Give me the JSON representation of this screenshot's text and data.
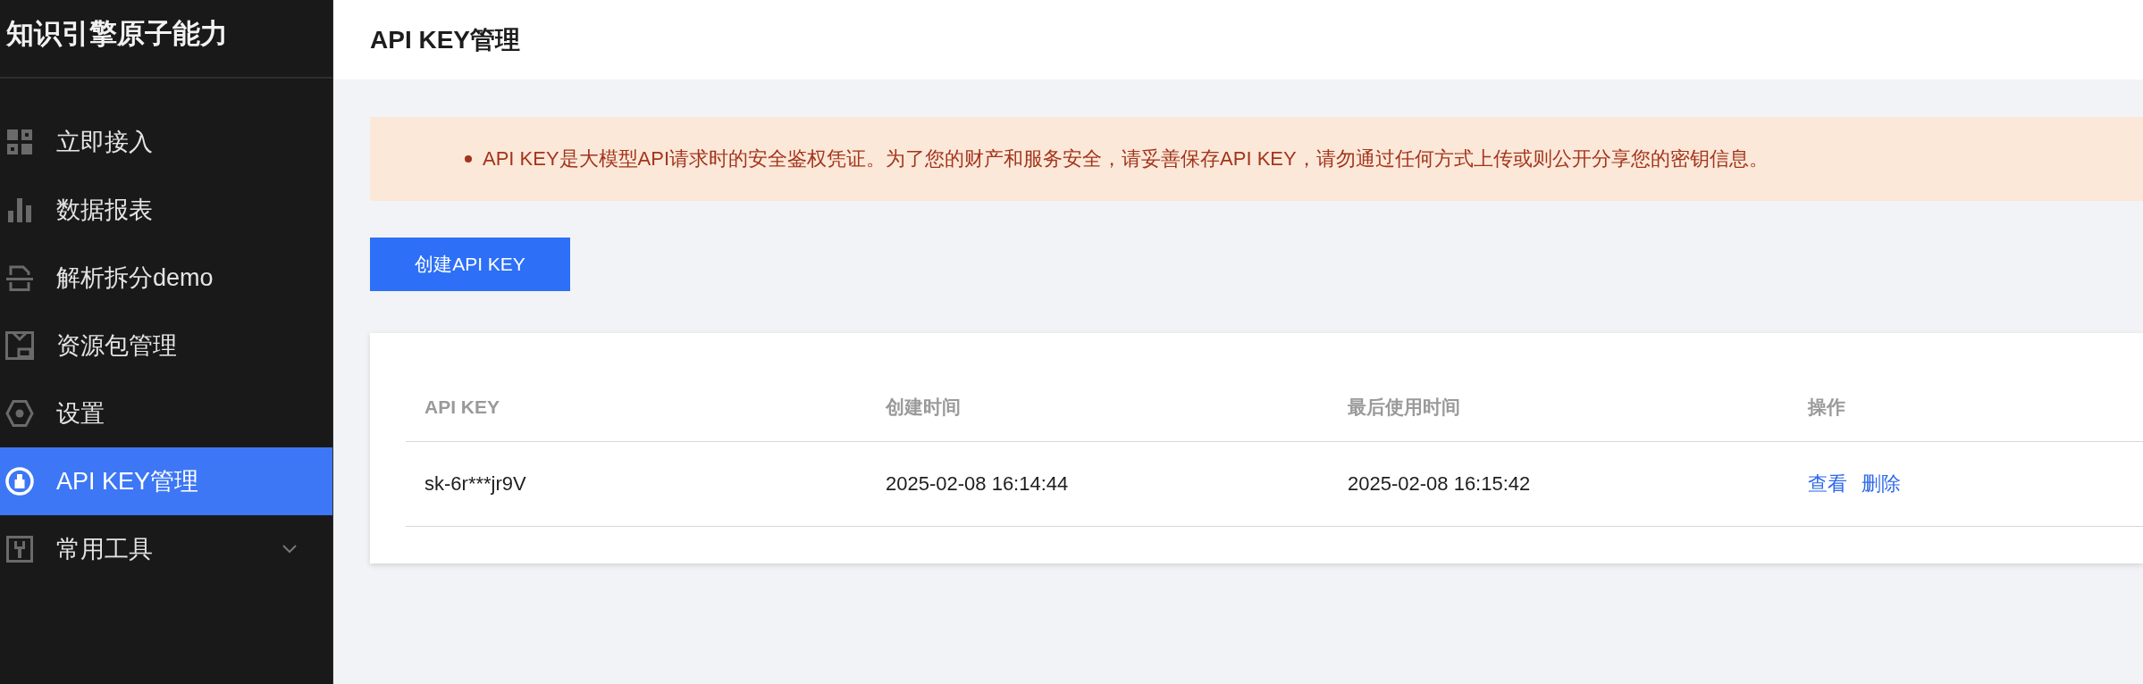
{
  "sidebar": {
    "title": "知识引擎原子能力",
    "items": [
      {
        "label": "立即接入",
        "kind": "link",
        "selected": false
      },
      {
        "label": "数据报表",
        "kind": "link",
        "selected": false
      },
      {
        "label": "解析拆分demo",
        "kind": "link",
        "selected": false
      },
      {
        "label": "资源包管理",
        "kind": "link",
        "selected": false
      },
      {
        "label": "设置",
        "kind": "link",
        "selected": false
      },
      {
        "label": "API KEY管理",
        "kind": "link",
        "selected": true
      },
      {
        "label": "常用工具",
        "kind": "group",
        "selected": false,
        "expanded": false
      }
    ]
  },
  "header": {
    "title": "API KEY管理"
  },
  "notice": {
    "items": [
      "API KEY是大模型API请求时的安全鉴权凭证。为了您的财产和服务安全，请妥善保存API KEY，请勿通过任何方式上传或则公开分享您的密钥信息。"
    ]
  },
  "create_button": {
    "label": "创建API KEY"
  },
  "table": {
    "columns": [
      "API KEY",
      "创建时间",
      "最后使用时间",
      "操作"
    ],
    "rows": [
      {
        "cells": [
          "sk-6r***jr9V",
          "2025-02-08 16:14:44",
          "2025-02-08 16:15:42"
        ],
        "actions": [
          "查看",
          "删除"
        ]
      }
    ]
  }
}
